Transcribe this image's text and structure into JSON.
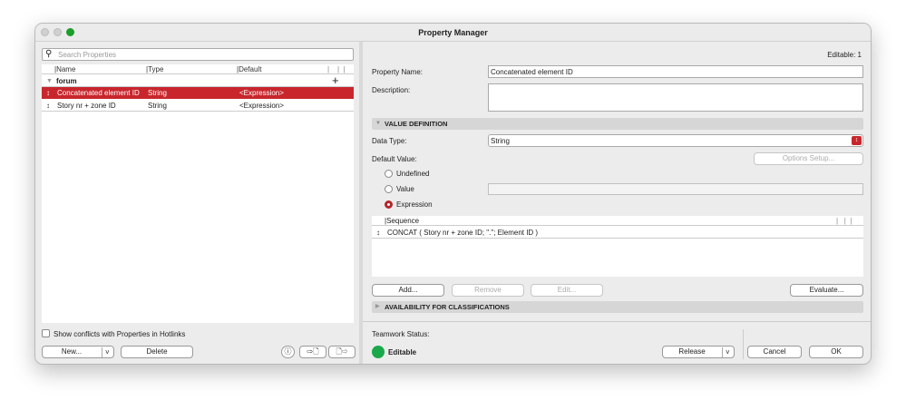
{
  "window": {
    "title": "Property Manager"
  },
  "left": {
    "search_placeholder": "Search Properties",
    "columns": [
      "|Name",
      "|Type",
      "|Default"
    ],
    "group": "forum",
    "rows": [
      {
        "name": "Concatenated element ID",
        "type": "String",
        "default": "<Expression>",
        "selected": true
      },
      {
        "name": "Story nr + zone ID",
        "type": "String",
        "default": "<Expression>",
        "selected": false
      }
    ],
    "show_conflicts": "Show conflicts with Properties in Hotlinks",
    "new_label": "New...",
    "delete_label": "Delete"
  },
  "right": {
    "editable_count": "Editable: 1",
    "property_name_label": "Property Name:",
    "property_name_value": "Concatenated element ID",
    "description_label": "Description:",
    "value_definition": "VALUE DEFINITION",
    "data_type_label": "Data Type:",
    "data_type_value": "String",
    "default_value_label": "Default Value:",
    "options_setup": "Options Setup...",
    "radios": [
      "Undefined",
      "Value",
      "Expression"
    ],
    "selected_radio": "Expression",
    "sequence_header": "|Sequence",
    "sequence_rows": [
      "CONCAT ( Story nr + zone ID; \".\"; Element ID )"
    ],
    "add": "Add...",
    "remove": "Remove",
    "edit": "Edit...",
    "evaluate": "Evaluate...",
    "availability": "AVAILABILITY FOR CLASSIFICATIONS",
    "teamwork_label": "Teamwork Status:",
    "teamwork_status": "Editable",
    "release": "Release",
    "cancel": "Cancel",
    "ok": "OK"
  },
  "colors": {
    "accent": "#c8262c",
    "status": "#1aa84a"
  }
}
